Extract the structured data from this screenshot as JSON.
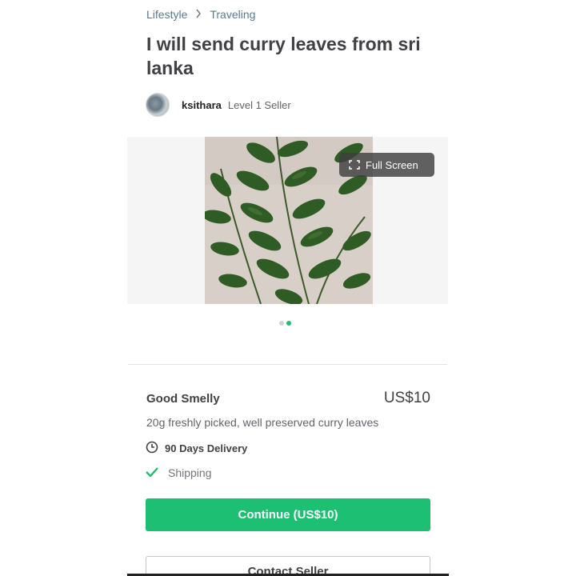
{
  "breadcrumb": {
    "items": [
      {
        "label": "Lifestyle"
      },
      {
        "label": "Traveling"
      }
    ],
    "separator_icon": "chevron-right-icon"
  },
  "gig": {
    "title": "I will send curry leaves from sri lanka"
  },
  "seller": {
    "name": "ksithara",
    "level": "Level 1 Seller"
  },
  "gallery": {
    "fullscreen_label": "Full Screen",
    "slide_count": 2,
    "active_slide": 2
  },
  "package": {
    "name": "Good Smelly",
    "price": "US$10",
    "description": "20g freshly picked, well preserved curry leaves",
    "delivery": "90 Days Delivery",
    "feature": "Shipping"
  },
  "actions": {
    "continue_label": "Continue (US$10)",
    "contact_label": "Contact Seller"
  },
  "colors": {
    "accent": "#1dbf73",
    "breadcrumb": "#5a7a8c",
    "text": "#404145"
  }
}
